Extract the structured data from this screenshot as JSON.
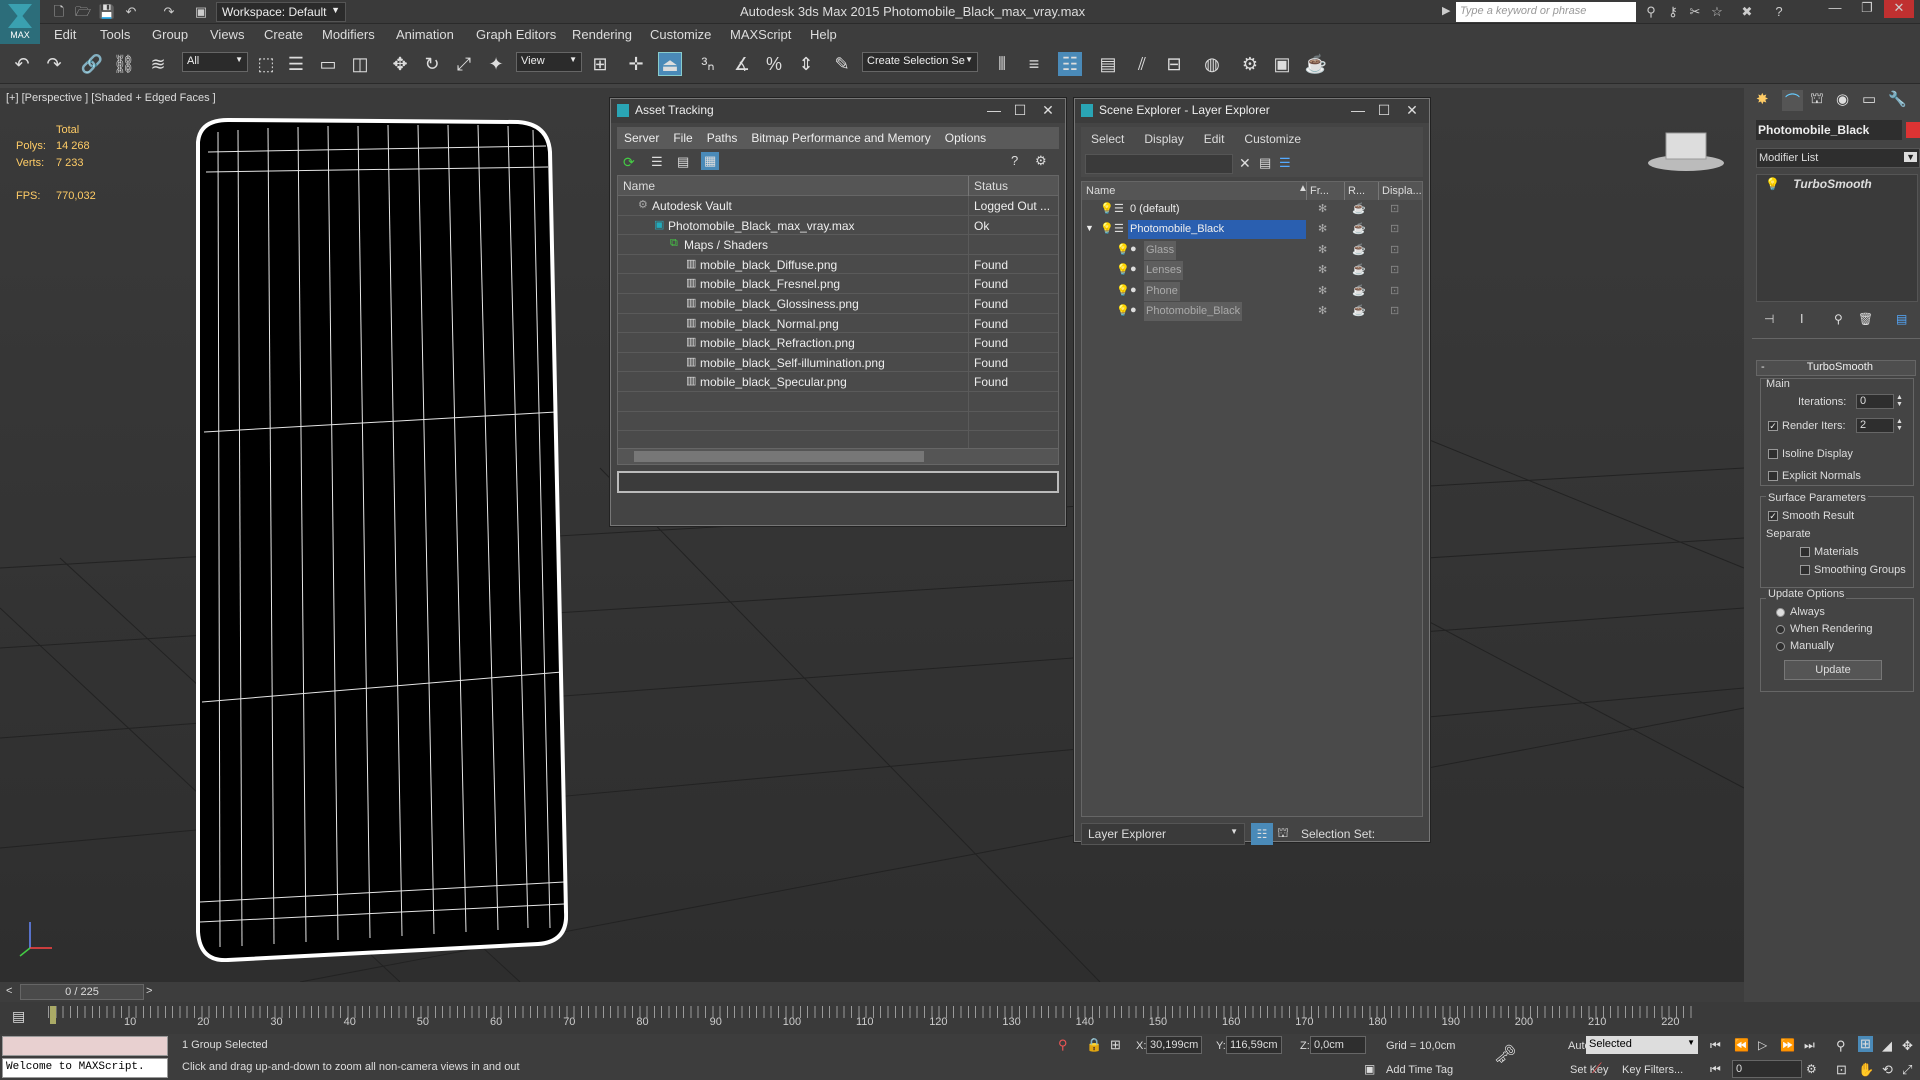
{
  "app": {
    "logo_label": "MAX",
    "workspace": "Workspace: Default",
    "title": "Autodesk 3ds Max  2015    Photomobile_Black_max_vray.max",
    "search_placeholder": "Type a keyword or phrase"
  },
  "menu": [
    "Edit",
    "Tools",
    "Group",
    "Views",
    "Create",
    "Modifiers",
    "Animation",
    "Graph Editors",
    "Rendering",
    "Customize",
    "MAXScript",
    "Help"
  ],
  "toolbar": {
    "filter": "All",
    "coord_system": "View",
    "selection_set": "Create Selection Se"
  },
  "viewport": {
    "label": "[+] [Perspective ] [Shaded + Edged Faces ]",
    "stats_total": "Total",
    "polys_label": "Polys:",
    "polys_value": "14 268",
    "verts_label": "Verts:",
    "verts_value": "7 233",
    "fps_label": "FPS:",
    "fps_value": "770,032"
  },
  "asset_tracking": {
    "title": "Asset Tracking",
    "menu": [
      "Server",
      "File",
      "Paths",
      "Bitmap Performance and Memory",
      "Options"
    ],
    "col_name": "Name",
    "col_status": "Status",
    "rows": [
      {
        "name": "Autodesk Vault",
        "status": "Logged Out ...",
        "indent": 1,
        "icon": "vault"
      },
      {
        "name": "Photomobile_Black_max_vray.max",
        "status": "Ok",
        "indent": 2,
        "icon": "max"
      },
      {
        "name": "Maps / Shaders",
        "status": "",
        "indent": 3,
        "icon": "maps"
      },
      {
        "name": "mobile_black_Diffuse.png",
        "status": "Found",
        "indent": 4,
        "icon": "img"
      },
      {
        "name": "mobile_black_Fresnel.png",
        "status": "Found",
        "indent": 4,
        "icon": "img"
      },
      {
        "name": "mobile_black_Glossiness.png",
        "status": "Found",
        "indent": 4,
        "icon": "img"
      },
      {
        "name": "mobile_black_Normal.png",
        "status": "Found",
        "indent": 4,
        "icon": "img"
      },
      {
        "name": "mobile_black_Refraction.png",
        "status": "Found",
        "indent": 4,
        "icon": "img"
      },
      {
        "name": "mobile_black_Self-illumination.png",
        "status": "Found",
        "indent": 4,
        "icon": "img"
      },
      {
        "name": "mobile_black_Specular.png",
        "status": "Found",
        "indent": 4,
        "icon": "img"
      }
    ]
  },
  "scene_explorer": {
    "title": "Scene Explorer - Layer Explorer",
    "menu": [
      "Select",
      "Display",
      "Edit",
      "Customize"
    ],
    "cols": [
      "Name",
      "Fr...",
      "R...",
      "Displa..."
    ],
    "rows": [
      {
        "name": "0 (default)",
        "level": 0,
        "selected": false,
        "dim": false
      },
      {
        "name": "Photomobile_Black",
        "level": 0,
        "selected": true,
        "dim": false
      },
      {
        "name": "Glass",
        "level": 1,
        "selected": false,
        "dim": true
      },
      {
        "name": "Lenses",
        "level": 1,
        "selected": false,
        "dim": true
      },
      {
        "name": "Phone",
        "level": 1,
        "selected": false,
        "dim": true
      },
      {
        "name": "Photomobile_Black",
        "level": 1,
        "selected": false,
        "dim": true
      }
    ],
    "footer_explorer": "Layer Explorer",
    "footer_selset": "Selection Set:"
  },
  "command_panel": {
    "object_name": "Photomobile_Black",
    "modifier_list": "Modifier List",
    "stack_item": "TurboSmooth",
    "rollout_title": "TurboSmooth",
    "main_label": "Main",
    "iterations_label": "Iterations:",
    "iterations_value": "0",
    "render_iters_label": "Render Iters:",
    "render_iters_value": "2",
    "isoline_label": "Isoline Display",
    "explicit_normals_label": "Explicit Normals",
    "surface_params_label": "Surface Parameters",
    "smooth_result_label": "Smooth Result",
    "separate_label": "Separate",
    "materials_label": "Materials",
    "smoothing_groups_label": "Smoothing Groups",
    "update_options_label": "Update Options",
    "always_label": "Always",
    "when_rendering_label": "When Rendering",
    "manually_label": "Manually",
    "update_button": "Update"
  },
  "timeline": {
    "frame_counter": "0 / 225",
    "ticks": [
      "10",
      "20",
      "30",
      "40",
      "50",
      "60",
      "70",
      "80",
      "90",
      "100",
      "110",
      "120",
      "130",
      "140",
      "150",
      "160",
      "170",
      "180",
      "190",
      "200",
      "210",
      "220"
    ]
  },
  "status": {
    "maxscript": "Welcome to MAXScript.",
    "selection": "1 Group Selected",
    "prompt": "Click and drag up-and-down to zoom all non-camera views in and out",
    "x_label": "X:",
    "x_value": "30,199cm",
    "y_label": "Y:",
    "y_value": "116,59cm",
    "z_label": "Z:",
    "z_value": "0,0cm",
    "grid": "Grid = 10,0cm",
    "add_time_tag": "Add Time Tag",
    "auto_key": "Auto Key",
    "set_key": "Set Key",
    "selected_dropdown": "Selected",
    "key_filters": "Key Filters...",
    "current_frame": "0"
  }
}
